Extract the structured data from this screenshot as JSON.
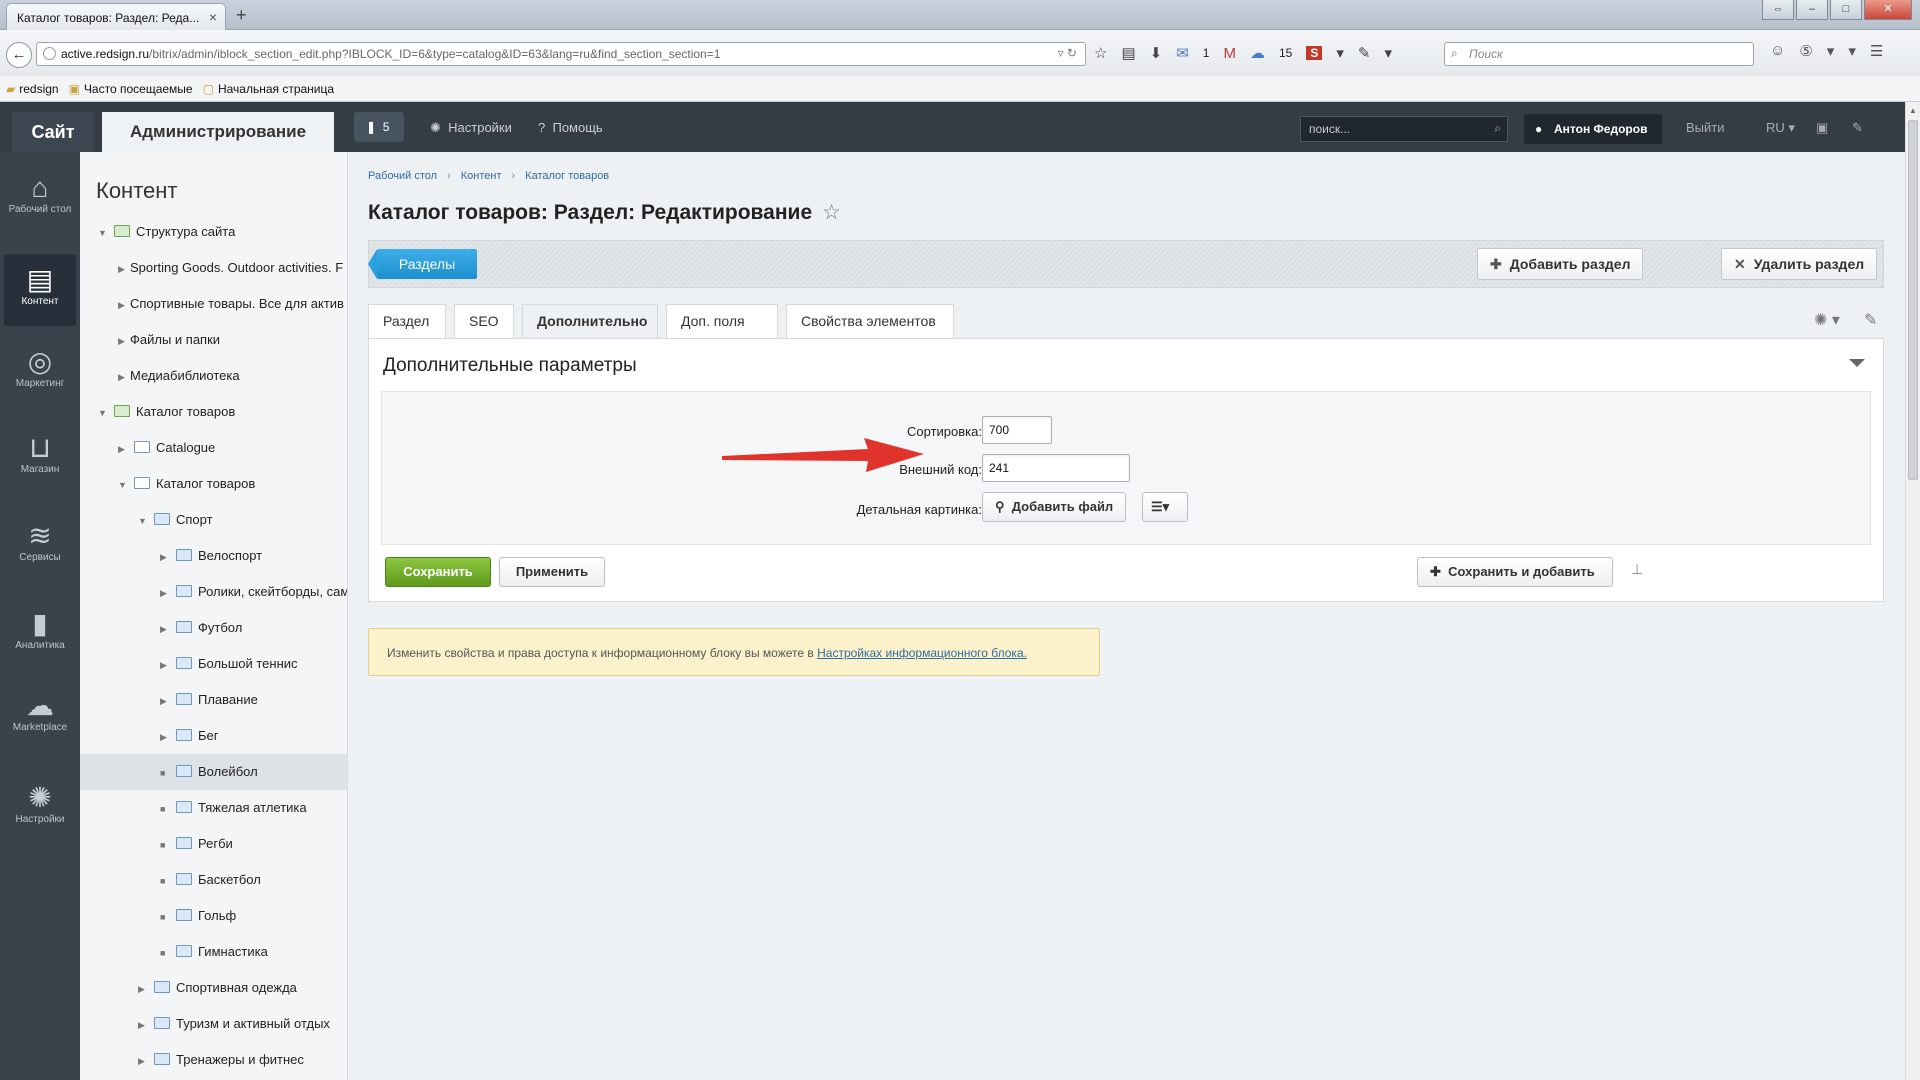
{
  "browser": {
    "tab_title": "Каталог товаров: Раздел: Реда...",
    "url_domain": "active.redsign.ru",
    "url_path": "/bitrix/admin/iblock_section_edit.php?IBLOCK_ID=6&type=catalog&ID=63&lang=ru&find_section_section=1",
    "mail_count": "1",
    "cloud_count": "15",
    "search_placeholder": "Поиск",
    "bookmarks": [
      "redsign",
      "Часто посещаемые",
      "Начальная страница"
    ]
  },
  "admin_bar": {
    "site_label": "Сайт",
    "admin_label": "Администрирование",
    "notifications_count": "5",
    "settings_label": "Настройки",
    "help_label": "Помощь",
    "search_placeholder": "поиск...",
    "user_name": "Антон Федоров",
    "logout_label": "Выйти",
    "lang_label": "RU"
  },
  "left_menu": [
    {
      "label": "Рабочий стол",
      "icon": "home-icon"
    },
    {
      "label": "Контент",
      "icon": "document-icon"
    },
    {
      "label": "Маркетинг",
      "icon": "target-icon"
    },
    {
      "label": "Магазин",
      "icon": "basket-icon"
    },
    {
      "label": "Сервисы",
      "icon": "layers-icon"
    },
    {
      "label": "Аналитика",
      "icon": "bar-chart-icon"
    },
    {
      "label": "Marketplace",
      "icon": "cloud-download-icon"
    },
    {
      "label": "Настройки",
      "icon": "gear-icon"
    }
  ],
  "tree": {
    "title": "Контент",
    "items": [
      {
        "label": "Структура сайта"
      },
      {
        "label": "Sporting Goods. Outdoor activities. F"
      },
      {
        "label": "Спортивные товары. Все для актив"
      },
      {
        "label": "Файлы и папки"
      },
      {
        "label": "Медиабиблиотека"
      },
      {
        "label": "Каталог товаров"
      },
      {
        "label": "Catalogue"
      },
      {
        "label": "Каталог товаров"
      },
      {
        "label": "Спорт"
      },
      {
        "label": "Велоспорт"
      },
      {
        "label": "Ролики, скейтборды, сам"
      },
      {
        "label": "Футбол"
      },
      {
        "label": "Большой теннис"
      },
      {
        "label": "Плавание"
      },
      {
        "label": "Бег"
      },
      {
        "label": "Волейбол"
      },
      {
        "label": "Тяжелая атлетика"
      },
      {
        "label": "Регби"
      },
      {
        "label": "Баскетбол"
      },
      {
        "label": "Гольф"
      },
      {
        "label": "Гимнастика"
      },
      {
        "label": "Спортивная одежда"
      },
      {
        "label": "Туризм и активный отдых"
      },
      {
        "label": "Тренажеры и фитнес"
      }
    ]
  },
  "breadcrumbs": [
    "Рабочий стол",
    "Контент",
    "Каталог товаров"
  ],
  "page_title": "Каталог товаров: Раздел: Редактирование",
  "toolbar": {
    "sections_label": "Разделы",
    "add_section_label": "Добавить раздел",
    "delete_section_label": "Удалить раздел"
  },
  "tabs": [
    "Раздел",
    "SEO",
    "Дополнительно",
    "Доп. поля",
    "Свойства элементов"
  ],
  "form": {
    "title": "Дополнительные параметры",
    "sort_label": "Сортировка:",
    "sort_value": "700",
    "external_code_label": "Внешний код:",
    "external_code_value": "241",
    "detail_picture_label": "Детальная картинка:",
    "add_file_label": "Добавить файл",
    "save_label": "Сохранить",
    "apply_label": "Применить",
    "save_and_add_label": "Сохранить и добавить"
  },
  "notice": {
    "text": "Изменить свойства и права доступа к информационному блоку вы можете в",
    "link_text": "Настройках информационного блока."
  },
  "colors": {
    "accent_blue": "#1b8fd0",
    "save_green": "#6aa822",
    "admin_dark": "#343c44",
    "annotation_arrow": "#e0332b"
  }
}
